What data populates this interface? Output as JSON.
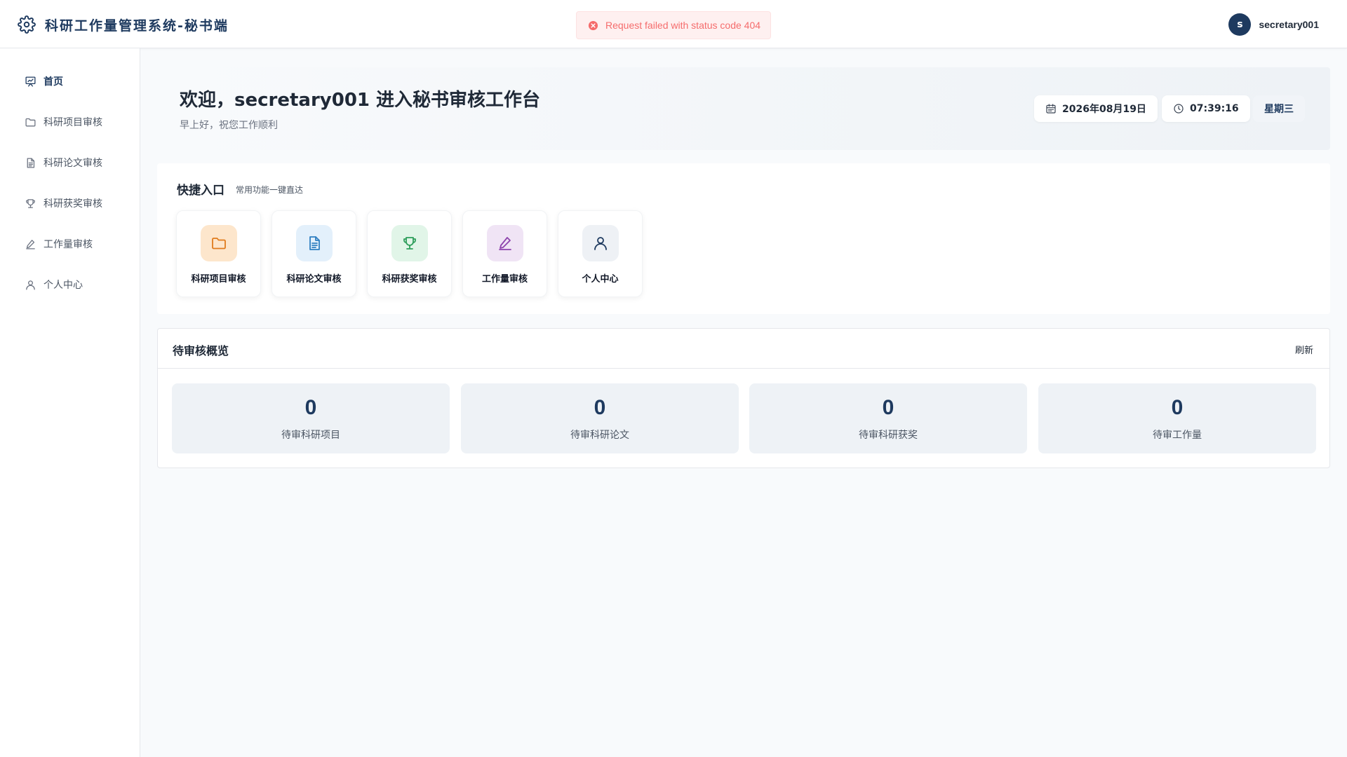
{
  "header": {
    "title": "科研工作量管理系统-秘书端",
    "logo_icon": "gear-icon",
    "toast": {
      "icon": "error-circle-icon",
      "message": "Request failed with status code 404",
      "color": "#f56c6c"
    },
    "user": {
      "avatar_initial": "s",
      "name": "secretary001"
    }
  },
  "sidebar": {
    "items": [
      {
        "label": "首页",
        "icon": "chart-board-icon",
        "active": true
      },
      {
        "label": "科研项目审核",
        "icon": "folder-icon",
        "active": false
      },
      {
        "label": "科研论文审核",
        "icon": "document-icon",
        "active": false
      },
      {
        "label": "科研获奖审核",
        "icon": "trophy-icon",
        "active": false
      },
      {
        "label": "工作量审核",
        "icon": "pencil-icon",
        "active": false
      },
      {
        "label": "个人中心",
        "icon": "user-icon",
        "active": false
      }
    ]
  },
  "welcome": {
    "title": "欢迎，secretary001 进入秘书审核工作台",
    "subtitle": "早上好，祝您工作顺利",
    "date": "2026年08月19日",
    "time": "07:39:16",
    "weekday": "星期三"
  },
  "quick": {
    "title": "快捷入口",
    "subtitle": "常用功能一键直达",
    "items": [
      {
        "label": "科研项目审核",
        "icon": "folder-icon",
        "bg": "#fde6cc",
        "color": "#e07b1c"
      },
      {
        "label": "科研论文审核",
        "icon": "document-icon",
        "bg": "#e3f0fb",
        "color": "#2f7fc1"
      },
      {
        "label": "科研获奖审核",
        "icon": "trophy-icon",
        "bg": "#e1f5e8",
        "color": "#2e9e5b"
      },
      {
        "label": "工作量审核",
        "icon": "pencil-icon",
        "bg": "#f0e4f5",
        "color": "#8e44ad"
      },
      {
        "label": "个人中心",
        "icon": "user-icon",
        "bg": "#eef1f5",
        "color": "#1e3a5f"
      }
    ]
  },
  "pending": {
    "title": "待审核概览",
    "refresh_label": "刷新",
    "stats": [
      {
        "value": "0",
        "label": "待审科研项目"
      },
      {
        "value": "0",
        "label": "待审科研论文"
      },
      {
        "value": "0",
        "label": "待审科研获奖"
      },
      {
        "value": "0",
        "label": "待审工作量"
      }
    ]
  }
}
